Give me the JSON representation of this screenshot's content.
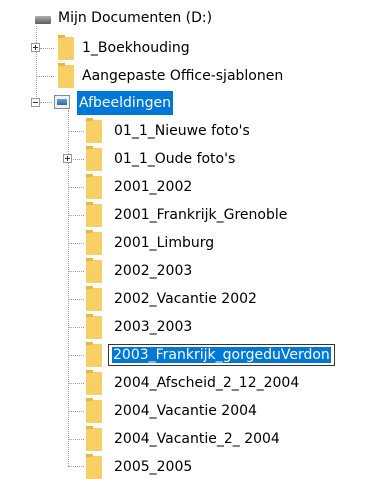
{
  "tree": {
    "drive": {
      "label": "Mijn Documenten (D:)",
      "icon": "drive-icon"
    },
    "items": [
      {
        "label": "1_Boekhouding",
        "expander": "plus",
        "icon": "folder-icon"
      },
      {
        "label": "Aangepaste Office-sjablonen",
        "icon": "folder-icon"
      },
      {
        "label": "Afbeeldingen",
        "expander": "minus",
        "icon": "pictures-folder-icon",
        "state": "selected"
      }
    ],
    "children": [
      {
        "label": "01_1_Nieuwe foto's"
      },
      {
        "label": "01_1_Oude foto's",
        "expander": "plus"
      },
      {
        "label": "2001_2002"
      },
      {
        "label": "2001_Frankrijk_Grenoble"
      },
      {
        "label": "2001_Limburg"
      },
      {
        "label": "2002_2003"
      },
      {
        "label": "2002_Vacantie 2002"
      },
      {
        "label": "2003_2003"
      },
      {
        "label": "2003_Frankrijk_gorgeduVerdon",
        "state": "editing"
      },
      {
        "label": "2004_Afscheid_2_12_2004"
      },
      {
        "label": "2004_Vacantie 2004"
      },
      {
        "label": "2004_Vacantie_2_ 2004"
      },
      {
        "label": "2005_2005"
      }
    ]
  },
  "colors": {
    "selection": "#0078d7",
    "folder": "#f7cf64",
    "tree_lines": "#a0a0a0"
  }
}
